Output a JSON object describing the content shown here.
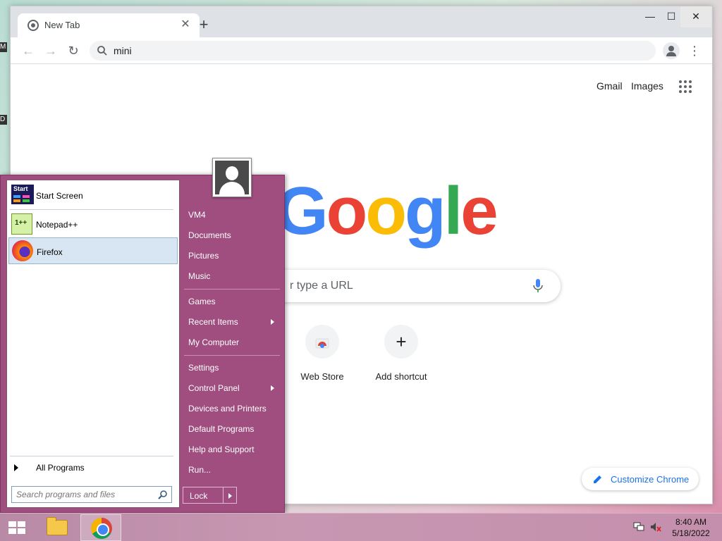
{
  "browser": {
    "tab_title": "New Tab",
    "tab_close": "✕",
    "new_tab": "+",
    "window_controls": {
      "minimize": "—",
      "maximize": "☐",
      "close": "✕"
    },
    "nav": {
      "back": "←",
      "forward": "→",
      "reload": "↻"
    },
    "address_bar_value": "mini",
    "menu": "⋮"
  },
  "ntp": {
    "links": {
      "gmail": "Gmail",
      "images": "Images"
    },
    "logo": {
      "G": "G",
      "o1": "o",
      "o2": "o",
      "g": "g",
      "l": "l",
      "e": "e"
    },
    "search_placeholder_visible": "r type a URL",
    "shortcuts": [
      {
        "label": "Web Store",
        "icon": "chrome-web-store-icon"
      },
      {
        "label": "Add shortcut",
        "icon": "plus-icon",
        "glyph": "+"
      }
    ],
    "customize_label": "Customize Chrome",
    "colors": {
      "blue": "#4285f4",
      "red": "#ea4335",
      "yellow": "#fbbc05",
      "green": "#34a853",
      "link": "#1a73e8"
    }
  },
  "start_menu": {
    "pinned": [
      {
        "label": "Start Screen",
        "icon": "start-screen-icon",
        "icon_text": "Start"
      },
      {
        "label": "Notepad++",
        "icon": "notepad-plus-plus-icon",
        "icon_text": "1++"
      },
      {
        "label": "Firefox",
        "icon": "firefox-icon",
        "selected": true
      }
    ],
    "all_programs": "All Programs",
    "search_placeholder": "Search programs and files",
    "right_items": [
      {
        "label": "VM4"
      },
      {
        "label": "Documents"
      },
      {
        "label": "Pictures"
      },
      {
        "label": "Music"
      },
      {
        "label": "Games"
      },
      {
        "label": "Recent Items",
        "submenu": true
      },
      {
        "label": "My Computer"
      },
      {
        "label": "Settings"
      },
      {
        "label": "Control Panel",
        "submenu": true
      },
      {
        "label": "Devices and Printers"
      },
      {
        "label": "Default Programs"
      },
      {
        "label": "Help and Support"
      },
      {
        "label": "Run..."
      }
    ],
    "lock_label": "Lock",
    "accent_color": "#a04e7f"
  },
  "taskbar": {
    "apps": [
      {
        "name": "File Explorer",
        "icon": "folder-icon"
      },
      {
        "name": "Google Chrome",
        "icon": "chrome-icon",
        "active": true
      }
    ],
    "clock_time": "8:40 AM",
    "clock_date": "5/18/2022"
  },
  "desktop": {
    "fragment_1": "M",
    "fragment_2": "D"
  }
}
